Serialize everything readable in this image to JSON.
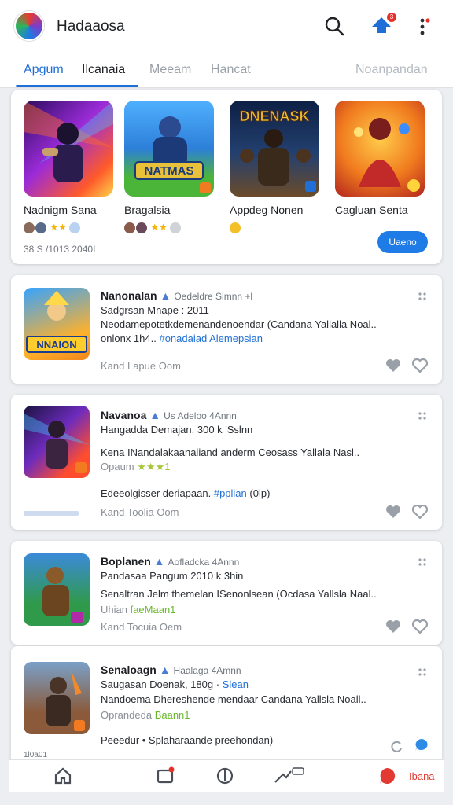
{
  "header": {
    "title": "Hadaaosa",
    "notif_count": "3",
    "icons": [
      "search-icon",
      "notification-icon",
      "more-icon"
    ]
  },
  "tabs": [
    {
      "label": "Apgum",
      "active": true
    },
    {
      "label": "Ilcanaia"
    },
    {
      "label": "Meeam"
    },
    {
      "label": "Hancat"
    },
    {
      "label": "Noanpandan"
    }
  ],
  "featured": {
    "items": [
      {
        "name": "Nadnigm Sana",
        "rating": "★★",
        "tile_text": ""
      },
      {
        "name": "Bragalsia",
        "rating": "★★",
        "tile_text": "NATMAS"
      },
      {
        "name": "Appdeg Nonen",
        "rating": "",
        "tile_text": "DNENASK"
      },
      {
        "name": "Cagluan Senta",
        "rating": "",
        "tile_text": ""
      }
    ],
    "footer": "38 S /1013 2040I",
    "button": "Uaeno"
  },
  "cards": [
    {
      "title": "Nanonalan",
      "meta": "Oedeldre Simnn +l",
      "line1": "Sadgrsan Mnape : 2011",
      "line2": "Neodamepotetkdemenandenoendar (Candana Yallalla Noal..",
      "line3a": "onlonx 1h4..",
      "line3b": "#onadaiad Alemepsian",
      "foot": "Kand Lapue Oom",
      "thumb_text": "NNAION"
    },
    {
      "title": "Navanoa",
      "meta": "Us Adeloo 4Annn",
      "line1": "Hangadda Demajan, 300 k 'Sslnn",
      "line2": "Kena INandalakaanaliand anderm Ceosass Yallala Nasl..",
      "line3a": "Opaum",
      "line3b": "★★★1",
      "line4a": "Edeeolgisser deriapaan.",
      "line4b": "#pplian",
      "line4c": "(0lp)",
      "foot": "Kand Toolia Oom"
    },
    {
      "title": "Boplanen",
      "meta": "Aofladcka 4Annn",
      "line1": "Pandasaa Pangum 2010 k 3hin",
      "line2": "Senaltran Jelm themelan ISenonlsean (Ocdasa Yallsla Naal..",
      "line3a": "Uhian",
      "line3b": "faeMaan1",
      "foot": "Kand Tocuia Oem"
    },
    {
      "title": "Senaloagn",
      "meta": "Haalaga 4Amnn",
      "line1": "Saugasan Doenak, 180g ·",
      "line1b": "Slean",
      "line2": "Nandoema Dhereshende mendaar Candana Yallsla Noall..",
      "line3a": "Oprandeda",
      "line3b": "Baann1",
      "line4a": "Peeedur • Splaharaande preehondan)"
    }
  ],
  "bottom_text": "1l0a01",
  "nav": {
    "items": [
      "home-icon",
      "inbox-icon",
      "explore-icon",
      "share-icon"
    ],
    "active_label": "Ibana"
  },
  "colors": {
    "accent": "#1f6fd6",
    "badge": "#e5312a",
    "star": "#f4b400"
  }
}
